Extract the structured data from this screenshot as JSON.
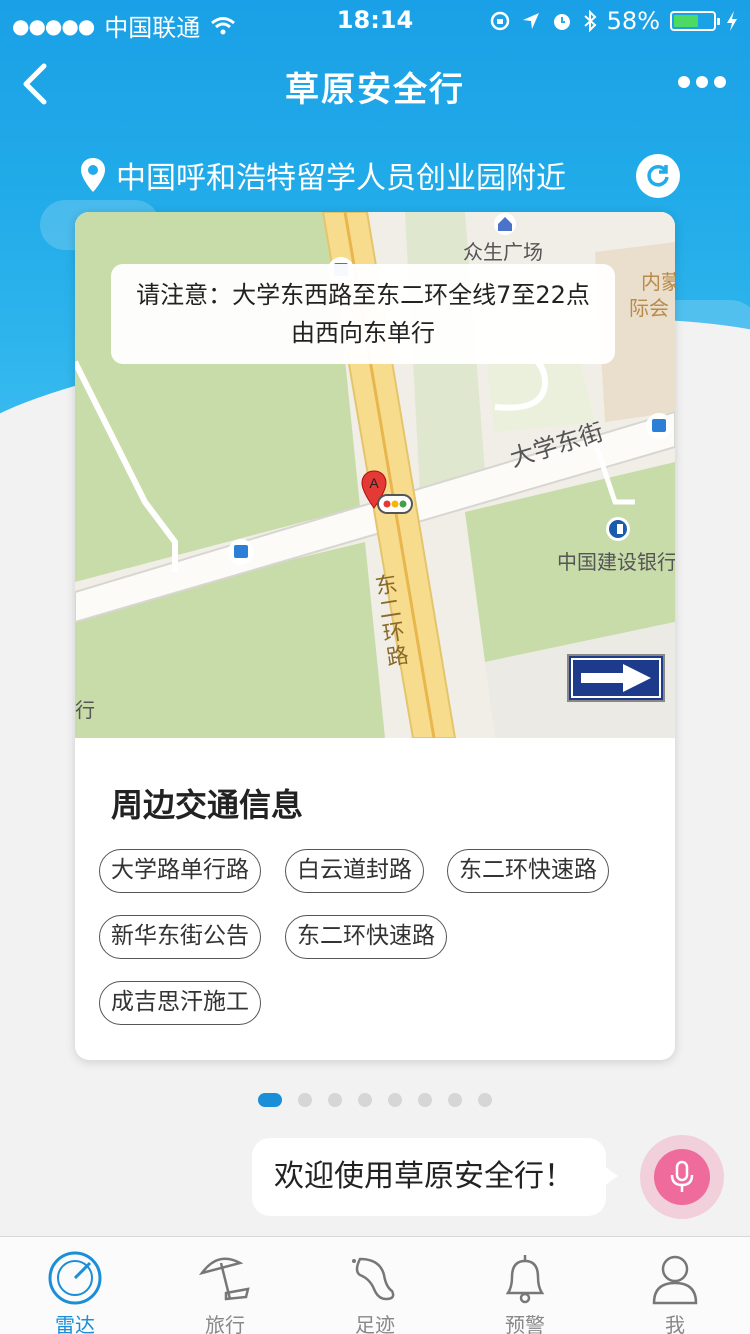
{
  "status_bar": {
    "carrier": "中国联通",
    "time": "18:14",
    "battery": "58%",
    "battery_level": 0.58
  },
  "nav": {
    "title": "草原安全行"
  },
  "location": {
    "text": "中国呼和浩特留学人员创业园附近"
  },
  "map": {
    "notice": "请注意：大学东西路至东二环全线7至22点由西向东单行",
    "labels": {
      "plaza": "众生广场",
      "inner_mongolia": "内蒙",
      "international": "际会",
      "street": "大学东街",
      "bank": "中国建设银行",
      "ring_road": "东二环路",
      "edge": "行"
    },
    "marker": "A"
  },
  "traffic": {
    "title": "周边交通信息",
    "tags": [
      "大学路单行路",
      "白云道封路",
      "东二环快速路",
      "新华东街公告",
      "东二环快速路",
      "成吉思汗施工"
    ]
  },
  "pager": {
    "count": 8,
    "active_index": 0
  },
  "assistant": {
    "welcome": "欢迎使用草原安全行！"
  },
  "tabbar": {
    "items": [
      {
        "label": "雷达",
        "icon": "radar-icon"
      },
      {
        "label": "旅行",
        "icon": "beach-umbrella-icon"
      },
      {
        "label": "足迹",
        "icon": "footprint-icon"
      },
      {
        "label": "预警",
        "icon": "bell-icon"
      },
      {
        "label": "我",
        "icon": "person-icon"
      }
    ],
    "active_index": 0
  },
  "colors": {
    "header_blue": "#1aa0e6",
    "accent": "#1a8fd8",
    "mic_pink": "#ee6b9c"
  }
}
